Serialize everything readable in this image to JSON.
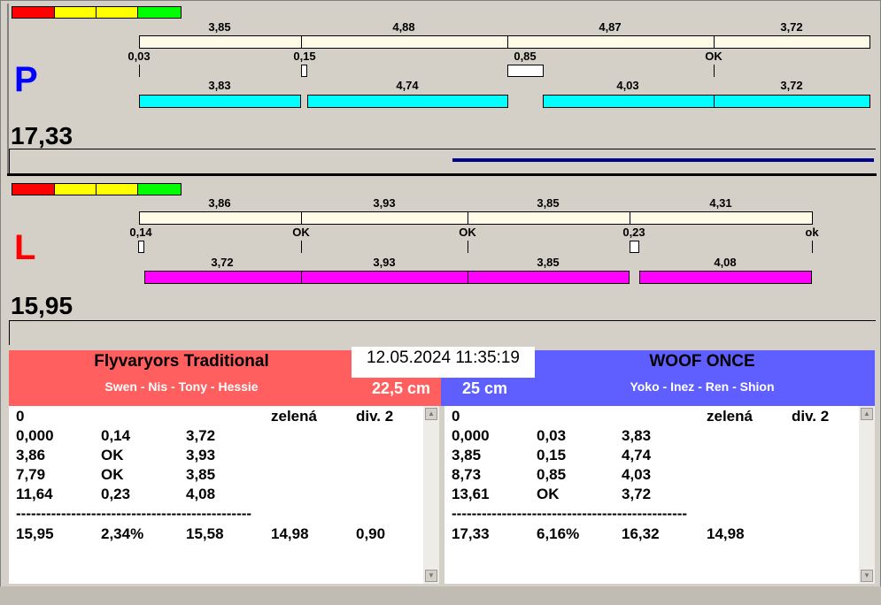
{
  "p": {
    "side": "P",
    "total": "17,33",
    "top": [
      "3,85",
      "4,88",
      "4,87",
      "3,72"
    ],
    "mid": [
      "0,03",
      "0,15",
      "0,85",
      "OK"
    ],
    "bottom": [
      "3,83",
      "4,74",
      "4,03",
      "3,72"
    ],
    "progress": 0.5
  },
  "l": {
    "side": "L",
    "total": "15,95",
    "top": [
      "3,86",
      "3,93",
      "3,85",
      "4,31"
    ],
    "mid": [
      "0,14",
      "OK",
      "OK",
      "0,23",
      "ok"
    ],
    "bottom": [
      "3,72",
      "3,93",
      "3,85",
      "4,08"
    ]
  },
  "datetime": "12.05.2024 11:35:19",
  "left_team": {
    "name": "Flyvaryors Traditional",
    "members": "Swen - Nis - Tony - Hessie",
    "size": "22,5 cm",
    "color": "#ff5f5f",
    "header": [
      "0",
      "zelená",
      "div. 2"
    ],
    "rows": [
      [
        "0,000",
        "0,14",
        "3,72"
      ],
      [
        "3,86",
        "OK",
        "3,93"
      ],
      [
        "7,79",
        "OK",
        "3,85"
      ],
      [
        "11,64",
        "0,23",
        "4,08"
      ]
    ],
    "separator": "-----------------------------------------------",
    "summary": [
      "15,95",
      "2,34%",
      "15,58",
      "14,98",
      "0,90"
    ]
  },
  "right_team": {
    "name": "WOOF ONCE",
    "members": "Yoko - Inez - Ren - Shion",
    "size": "25 cm",
    "color": "#5f5fff",
    "header": [
      "0",
      "zelená",
      "div. 2"
    ],
    "rows": [
      [
        "0,000",
        "0,03",
        "3,83"
      ],
      [
        "3,85",
        "0,15",
        "4,74"
      ],
      [
        "8,73",
        "0,85",
        "4,03"
      ],
      [
        "13,61",
        "OK",
        "3,72"
      ]
    ],
    "separator": "-----------------------------------------------",
    "summary": [
      "17,33",
      "6,16%",
      "16,32",
      "14,98"
    ]
  }
}
